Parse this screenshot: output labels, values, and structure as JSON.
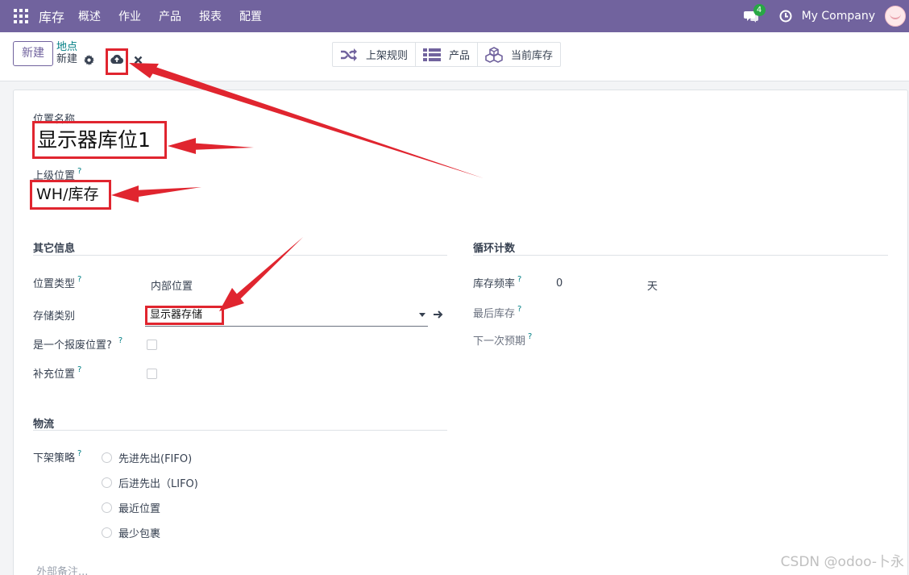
{
  "navbar": {
    "app_title": "库存",
    "menu": [
      "概述",
      "作业",
      "产品",
      "报表",
      "配置"
    ],
    "messages_badge": "4",
    "company": "My Company"
  },
  "control_panel": {
    "new_button": "新建",
    "breadcrumb_parent": "地点",
    "breadcrumb_current": "新建",
    "smart_buttons": [
      "上架规则",
      "产品",
      "当前库存"
    ]
  },
  "form": {
    "name_label": "位置名称",
    "name_value": "显示器库位1",
    "parent_label": "上级位置",
    "parent_value": "WH/库存",
    "help_mark": "?",
    "other_info": {
      "title": "其它信息",
      "location_type_label": "位置类型",
      "location_type_value": "内部位置",
      "storage_category_label": "存储类别",
      "storage_category_value": "显示器存储",
      "scrap_label": "是一个报废位置?",
      "replenish_label": "补充位置"
    },
    "cycle_count": {
      "title": "循环计数",
      "frequency_label": "库存频率",
      "frequency_value": "0",
      "frequency_unit": "天",
      "last_inventory_label": "最后库存",
      "next_expected_label": "下一次预期"
    },
    "logistics": {
      "title": "物流",
      "removal_strategy_label": "下架策略",
      "options": [
        "先进先出(FIFO)",
        "后进先出（LIFO)",
        "最近位置",
        "最少包裹"
      ]
    },
    "notes_placeholder": "外部备注..."
  },
  "watermark": "CSDN @odoo-卜永",
  "colors": {
    "navbar": "#71639e",
    "annotation": "#e0252f",
    "link": "#017e84"
  }
}
